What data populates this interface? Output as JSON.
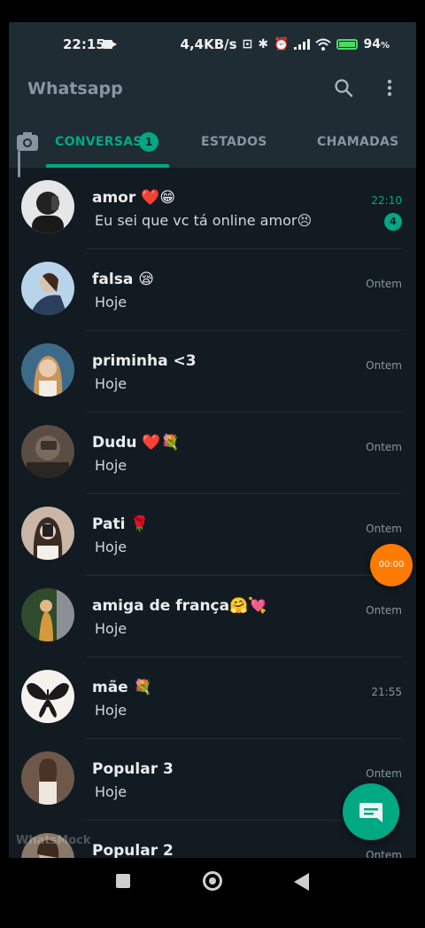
{
  "status_bar": {
    "time": "22:15",
    "network_speed": "4,4KB/s",
    "battery_percent": "94",
    "battery_suffix": "%"
  },
  "app_bar": {
    "title": "Whatsapp"
  },
  "tabs": [
    {
      "label": "CONVERSAS",
      "badge": "1",
      "active": true
    },
    {
      "label": "ESTADOS",
      "active": false
    },
    {
      "label": "CHAMADAS",
      "active": false
    }
  ],
  "chats": [
    {
      "name": "amor ❤️😁",
      "message": "Eu sei que vc tá online amor😣",
      "time": "22:10",
      "unread": "4",
      "avatar_color": "#e8e8e8"
    },
    {
      "name": "falsa 😪",
      "message": "Hoje",
      "time": "Ontem",
      "avatar_color": "#4a6a8a"
    },
    {
      "name": "priminha <3",
      "message": "Hoje",
      "time": "Ontem",
      "avatar_color": "#c8a070"
    },
    {
      "name": "Dudu ❤️💐",
      "message": "Hoje",
      "time": "Ontem",
      "avatar_color": "#6a5a4a"
    },
    {
      "name": "Pati 🌹",
      "message": "Hoje",
      "time": "Ontem",
      "avatar_color": "#9a8070"
    },
    {
      "name": "amiga de frança🤗💘",
      "message": "Hoje",
      "time": "Ontem",
      "avatar_color": "#3a5a3a"
    },
    {
      "name": "mãe 💐",
      "message": "Hoje",
      "time": "21:55",
      "avatar_color": "#f0f0f0"
    },
    {
      "name": "Popular 3",
      "message": "Hoje",
      "time": "Ontem",
      "avatar_color": "#7a6050"
    },
    {
      "name": "Popular 2",
      "message": "",
      "time": "Ontem",
      "avatar_color": "#8a7a6a"
    }
  ],
  "floating": {
    "timer": "00:00",
    "watermark": "WhatsMock"
  },
  "colors": {
    "accent": "#00a884",
    "header": "#1f2c34",
    "background": "#121b22",
    "timer": "#ff7a00"
  }
}
